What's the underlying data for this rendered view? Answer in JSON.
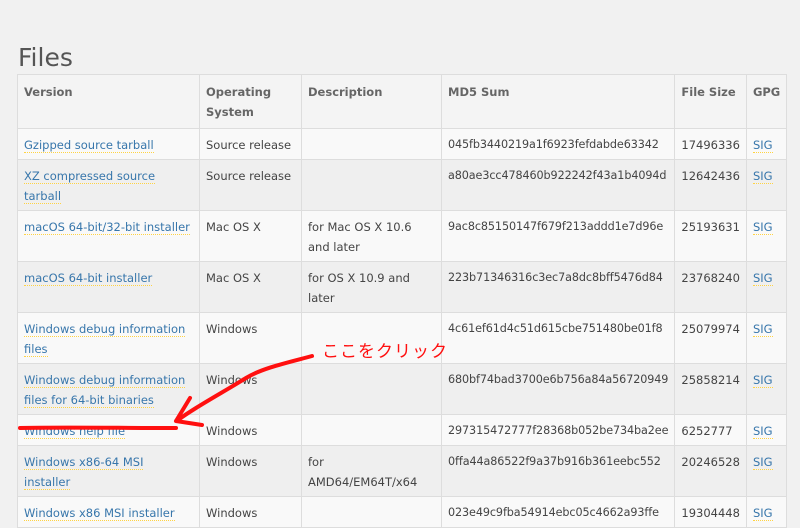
{
  "page": {
    "title": "Files"
  },
  "table": {
    "headers": {
      "version": "Version",
      "os": "Operating System",
      "description": "Description",
      "md5": "MD5 Sum",
      "size": "File Size",
      "gpg": "GPG"
    },
    "rows": [
      {
        "version": "Gzipped source tarball",
        "os": "Source release",
        "description": "",
        "md5": "045fb3440219a1f6923fefdabde63342",
        "size": "17496336",
        "gpg": "SIG"
      },
      {
        "version": "XZ compressed source tarball",
        "os": "Source release",
        "description": "",
        "md5": "a80ae3cc478460b922242f43a1b4094d",
        "size": "12642436",
        "gpg": "SIG"
      },
      {
        "version": "macOS 64-bit/32-bit installer",
        "os": "Mac OS X",
        "description": "for Mac OS X 10.6 and later",
        "md5": "9ac8c85150147f679f213addd1e7d96e",
        "size": "25193631",
        "gpg": "SIG"
      },
      {
        "version": "macOS 64-bit installer",
        "os": "Mac OS X",
        "description": "for OS X 10.9 and later",
        "md5": "223b71346316c3ec7a8dc8bff5476d84",
        "size": "23768240",
        "gpg": "SIG"
      },
      {
        "version": "Windows debug information files",
        "os": "Windows",
        "description": "",
        "md5": "4c61ef61d4c51d615cbe751480be01f8",
        "size": "25079974",
        "gpg": "SIG"
      },
      {
        "version": "Windows debug information files for 64-bit binaries",
        "os": "Windows",
        "description": "",
        "md5": "680bf74bad3700e6b756a84a56720949",
        "size": "25858214",
        "gpg": "SIG"
      },
      {
        "version": "Windows help file",
        "os": "Windows",
        "description": "",
        "md5": "297315472777f28368b052be734ba2ee",
        "size": "6252777",
        "gpg": "SIG"
      },
      {
        "version": "Windows x86-64 MSI installer",
        "os": "Windows",
        "description": "for AMD64/EM64T/x64",
        "md5": "0ffa44a86522f9a37b916b361eebc552",
        "size": "20246528",
        "gpg": "SIG"
      },
      {
        "version": "Windows x86 MSI installer",
        "os": "Windows",
        "description": "",
        "md5": "023e49c9fba54914ebc05c4662a93ffe",
        "size": "19304448",
        "gpg": "SIG"
      }
    ]
  },
  "annotation": {
    "text": "ここをクリック",
    "color": "#ff1010"
  },
  "colors": {
    "link": "#3776ab",
    "link_underline": "#ffd343"
  }
}
